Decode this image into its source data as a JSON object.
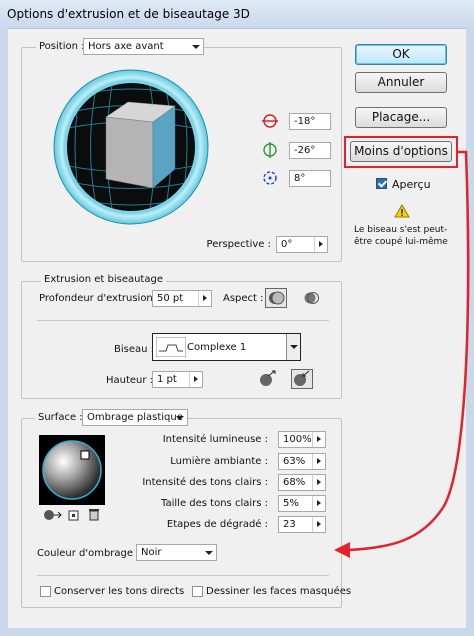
{
  "window": {
    "title": "Options d'extrusion et de biseautage 3D"
  },
  "position": {
    "label": "Position :",
    "value": "Hors axe avant",
    "angle_x": "-18°",
    "angle_y": "-26°",
    "angle_z": "8°",
    "perspective_label": "Perspective :",
    "perspective_value": "0°"
  },
  "extrusion": {
    "group_label": "Extrusion et biseautage",
    "depth_label": "Profondeur d'extrusion :",
    "depth_value": "50 pt",
    "aspect_label": "Aspect :",
    "bevel_label": "Biseau :",
    "bevel_value": "Complexe 1",
    "height_label": "Hauteur :",
    "height_value": "1 pt"
  },
  "surface": {
    "label": "Surface :",
    "value": "Ombrage plastique",
    "rows": [
      {
        "label": "Intensité lumineuse :",
        "value": "100%"
      },
      {
        "label": "Lumière ambiante :",
        "value": "63%"
      },
      {
        "label": "Intensité des tons clairs :",
        "value": "68%"
      },
      {
        "label": "Taille des tons clairs :",
        "value": "5%"
      },
      {
        "label": "Etapes de dégradé :",
        "value": "23"
      }
    ],
    "shade_color_label": "Couleur d'ombrage :",
    "shade_color_value": "Noir",
    "keep_spot_label": "Conserver les tons directs",
    "draw_hidden_label": "Dessiner les faces masquées"
  },
  "buttons": {
    "ok": "OK",
    "cancel": "Annuler",
    "map": "Placage...",
    "fewer_options": "Moins d'options"
  },
  "preview": {
    "label": "Aperçu",
    "checked": true
  },
  "warning": {
    "text": "Le biseau s'est peut-être coupé lui-même"
  },
  "colors": {
    "annotation_red": "#e0232c",
    "cube_face": "#5ba3c2",
    "track_ring": "#2bb6d4"
  }
}
